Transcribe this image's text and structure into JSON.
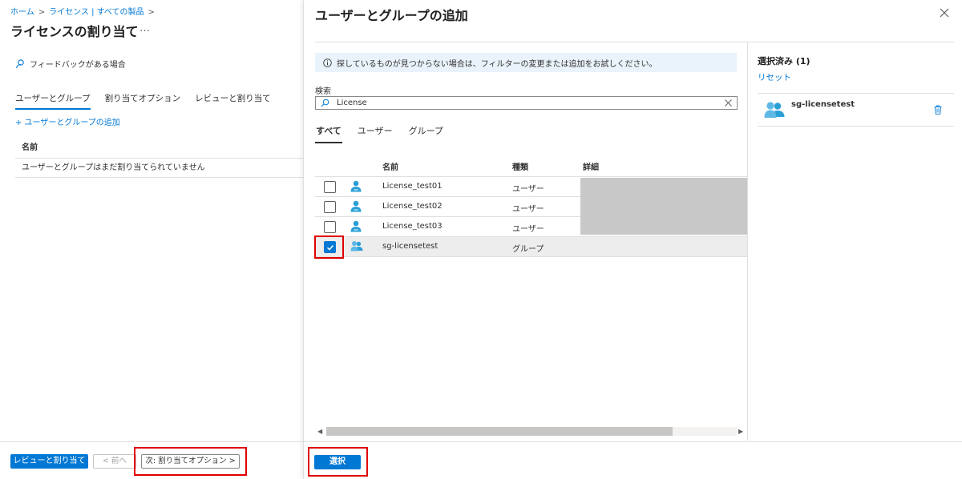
{
  "left": {
    "breadcrumb": [
      "ホーム",
      "ライセンス | すべての製品"
    ],
    "title": "ライセンスの割り当て",
    "more": "…",
    "feedback": "フィードバックがある場合",
    "tabs": [
      {
        "label": "ユーザーとグループ",
        "active": true
      },
      {
        "label": "割り当てオプション",
        "active": false
      },
      {
        "label": "レビューと割り当て",
        "active": false
      }
    ],
    "add_link": "+ ユーザーとグループの追加",
    "table_header": "名前",
    "empty_message": "ユーザーとグループはまだ割り当てられていません",
    "footer": {
      "review_button": "レビューと割り当て",
      "prev_button": "< 前へ",
      "next_button": "次: 割り当てオプション >"
    }
  },
  "modal": {
    "title": "ユーザーとグループの追加",
    "info": "探しているものが見つからない場合は、フィルターの変更または追加をお試しください。",
    "search_label": "検索",
    "search_value": "License",
    "tabs": [
      {
        "label": "すべて",
        "active": true
      },
      {
        "label": "ユーザー",
        "active": false
      },
      {
        "label": "グループ",
        "active": false
      }
    ],
    "columns": [
      "名前",
      "種類",
      "詳細"
    ],
    "rows": [
      {
        "name": "License_test01",
        "type": "ユーザー",
        "kind": "user",
        "checked": false
      },
      {
        "name": "License_test02",
        "type": "ユーザー",
        "kind": "user",
        "checked": false
      },
      {
        "name": "License_test03",
        "type": "ユーザー",
        "kind": "user",
        "checked": false
      },
      {
        "name": "sg-licensetest",
        "type": "グループ",
        "kind": "group",
        "checked": true
      }
    ],
    "selected_title": "選択済み (1)",
    "reset": "リセット",
    "selected_items": [
      "sg-licensetest"
    ],
    "select_button": "選択"
  },
  "colors": {
    "accent": "#0078d4",
    "highlight": "#e00000",
    "user_icon": "#2a9fd6"
  }
}
